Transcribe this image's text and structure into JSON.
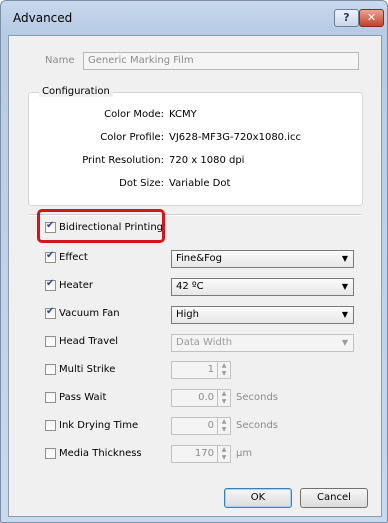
{
  "window": {
    "title": "Advanced",
    "help_glyph": "?",
    "close_glyph": "✕"
  },
  "name": {
    "label": "Name",
    "value": "Generic Marking Film"
  },
  "configuration": {
    "title": "Configuration",
    "color_mode_label": "Color Mode:",
    "color_mode": "KCMY",
    "color_profile_label": "Color Profile:",
    "color_profile": "VJ628-MF3G-720x1080.icc",
    "print_resolution_label": "Print Resolution:",
    "print_resolution": "720 x 1080 dpi",
    "dot_size_label": "Dot Size:",
    "dot_size": "Variable Dot"
  },
  "options": {
    "bidirectional": {
      "label": "Bidirectional Printing",
      "checked": true
    },
    "effect": {
      "label": "Effect",
      "checked": true,
      "value": "Fine&Fog"
    },
    "heater": {
      "label": "Heater",
      "checked": true,
      "value": "42 ºC"
    },
    "vacuum_fan": {
      "label": "Vacuum Fan",
      "checked": true,
      "value": "High"
    },
    "head_travel": {
      "label": "Head Travel",
      "checked": false,
      "value": "Data Width"
    },
    "multi_strike": {
      "label": "Multi Strike",
      "checked": false,
      "value": "1"
    },
    "pass_wait": {
      "label": "Pass Wait",
      "checked": false,
      "value": "0.0",
      "unit": "Seconds"
    },
    "ink_drying_time": {
      "label": "Ink Drying Time",
      "checked": false,
      "value": "0",
      "unit": "Seconds"
    },
    "media_thickness": {
      "label": "Media Thickness",
      "checked": false,
      "value": "170",
      "unit": "µm"
    }
  },
  "buttons": {
    "ok": "OK",
    "cancel": "Cancel"
  },
  "colors": {
    "highlight": "#d0151b"
  }
}
